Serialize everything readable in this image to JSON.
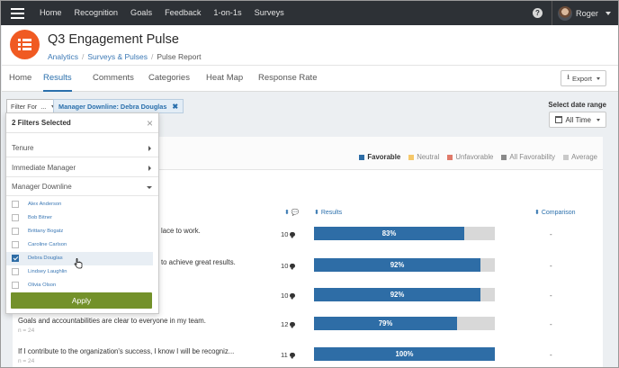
{
  "topnav": {
    "links": [
      "Home",
      "Recognition",
      "Goals",
      "Feedback",
      "1-on-1s",
      "Surveys"
    ],
    "help": "?",
    "user": "Roger"
  },
  "header": {
    "title": "Q3 Engagement Pulse",
    "breadcrumb": [
      "Analytics",
      "Surveys & Pulses",
      "Pulse Report"
    ]
  },
  "tabs": [
    "Home",
    "Results",
    "Comments",
    "Categories",
    "Heat Map",
    "Response Rate"
  ],
  "active_tab": "Results",
  "export_label": "Export",
  "filter": {
    "button_label": "Filter For",
    "chip_label": "Manager Downline: Debra Douglas",
    "date_range_label": "Select date range",
    "date_range_value": "All Time"
  },
  "legend": [
    {
      "label": "Favorable",
      "color": "#2e6da6",
      "active": true
    },
    {
      "label": "Neutral",
      "color": "#f5c86a",
      "active": false
    },
    {
      "label": "Unfavorable",
      "color": "#e07a6a",
      "active": false
    },
    {
      "label": "All Favorability",
      "color": "#8a8a8a",
      "active": false
    },
    {
      "label": "Average",
      "color": "#c9c9c9",
      "active": false
    }
  ],
  "columns": {
    "count_sort": "⬍",
    "results": "Results",
    "comparison": "Comparison"
  },
  "rows": [
    {
      "question": "lace to work.",
      "n": "",
      "count": "10",
      "favorable_pct": 83,
      "label": "83%",
      "comparison": "-"
    },
    {
      "question": "to achieve great results.",
      "n": "",
      "count": "10",
      "favorable_pct": 92,
      "label": "92%",
      "comparison": "-"
    },
    {
      "question": "",
      "n": "",
      "count": "10",
      "favorable_pct": 92,
      "label": "92%",
      "comparison": "-"
    },
    {
      "question": "Goals and accountabilities are clear to everyone in my team.",
      "n": "n = 24",
      "count": "12",
      "favorable_pct": 79,
      "label": "79%",
      "comparison": "-"
    },
    {
      "question": "If I contribute to the organization's success, I know I will be recogniz...",
      "n": "n = 24",
      "count": "11",
      "favorable_pct": 100,
      "label": "100%",
      "comparison": "-"
    }
  ],
  "filter_panel": {
    "title": "2 Filters Selected",
    "close": "×",
    "categories": [
      "Tenure",
      "Immediate Manager",
      "Manager Downline"
    ],
    "options": [
      {
        "label": "Alex Anderson",
        "checked": false
      },
      {
        "label": "Bob Bitner",
        "checked": false
      },
      {
        "label": "Brittany Bogatz",
        "checked": false
      },
      {
        "label": "Caroline Carlson",
        "checked": false
      },
      {
        "label": "Debra Douglas",
        "checked": true
      },
      {
        "label": "Lindsey Laughlin",
        "checked": false
      },
      {
        "label": "Olivia Olson",
        "checked": false
      }
    ],
    "apply_label": "Apply"
  }
}
